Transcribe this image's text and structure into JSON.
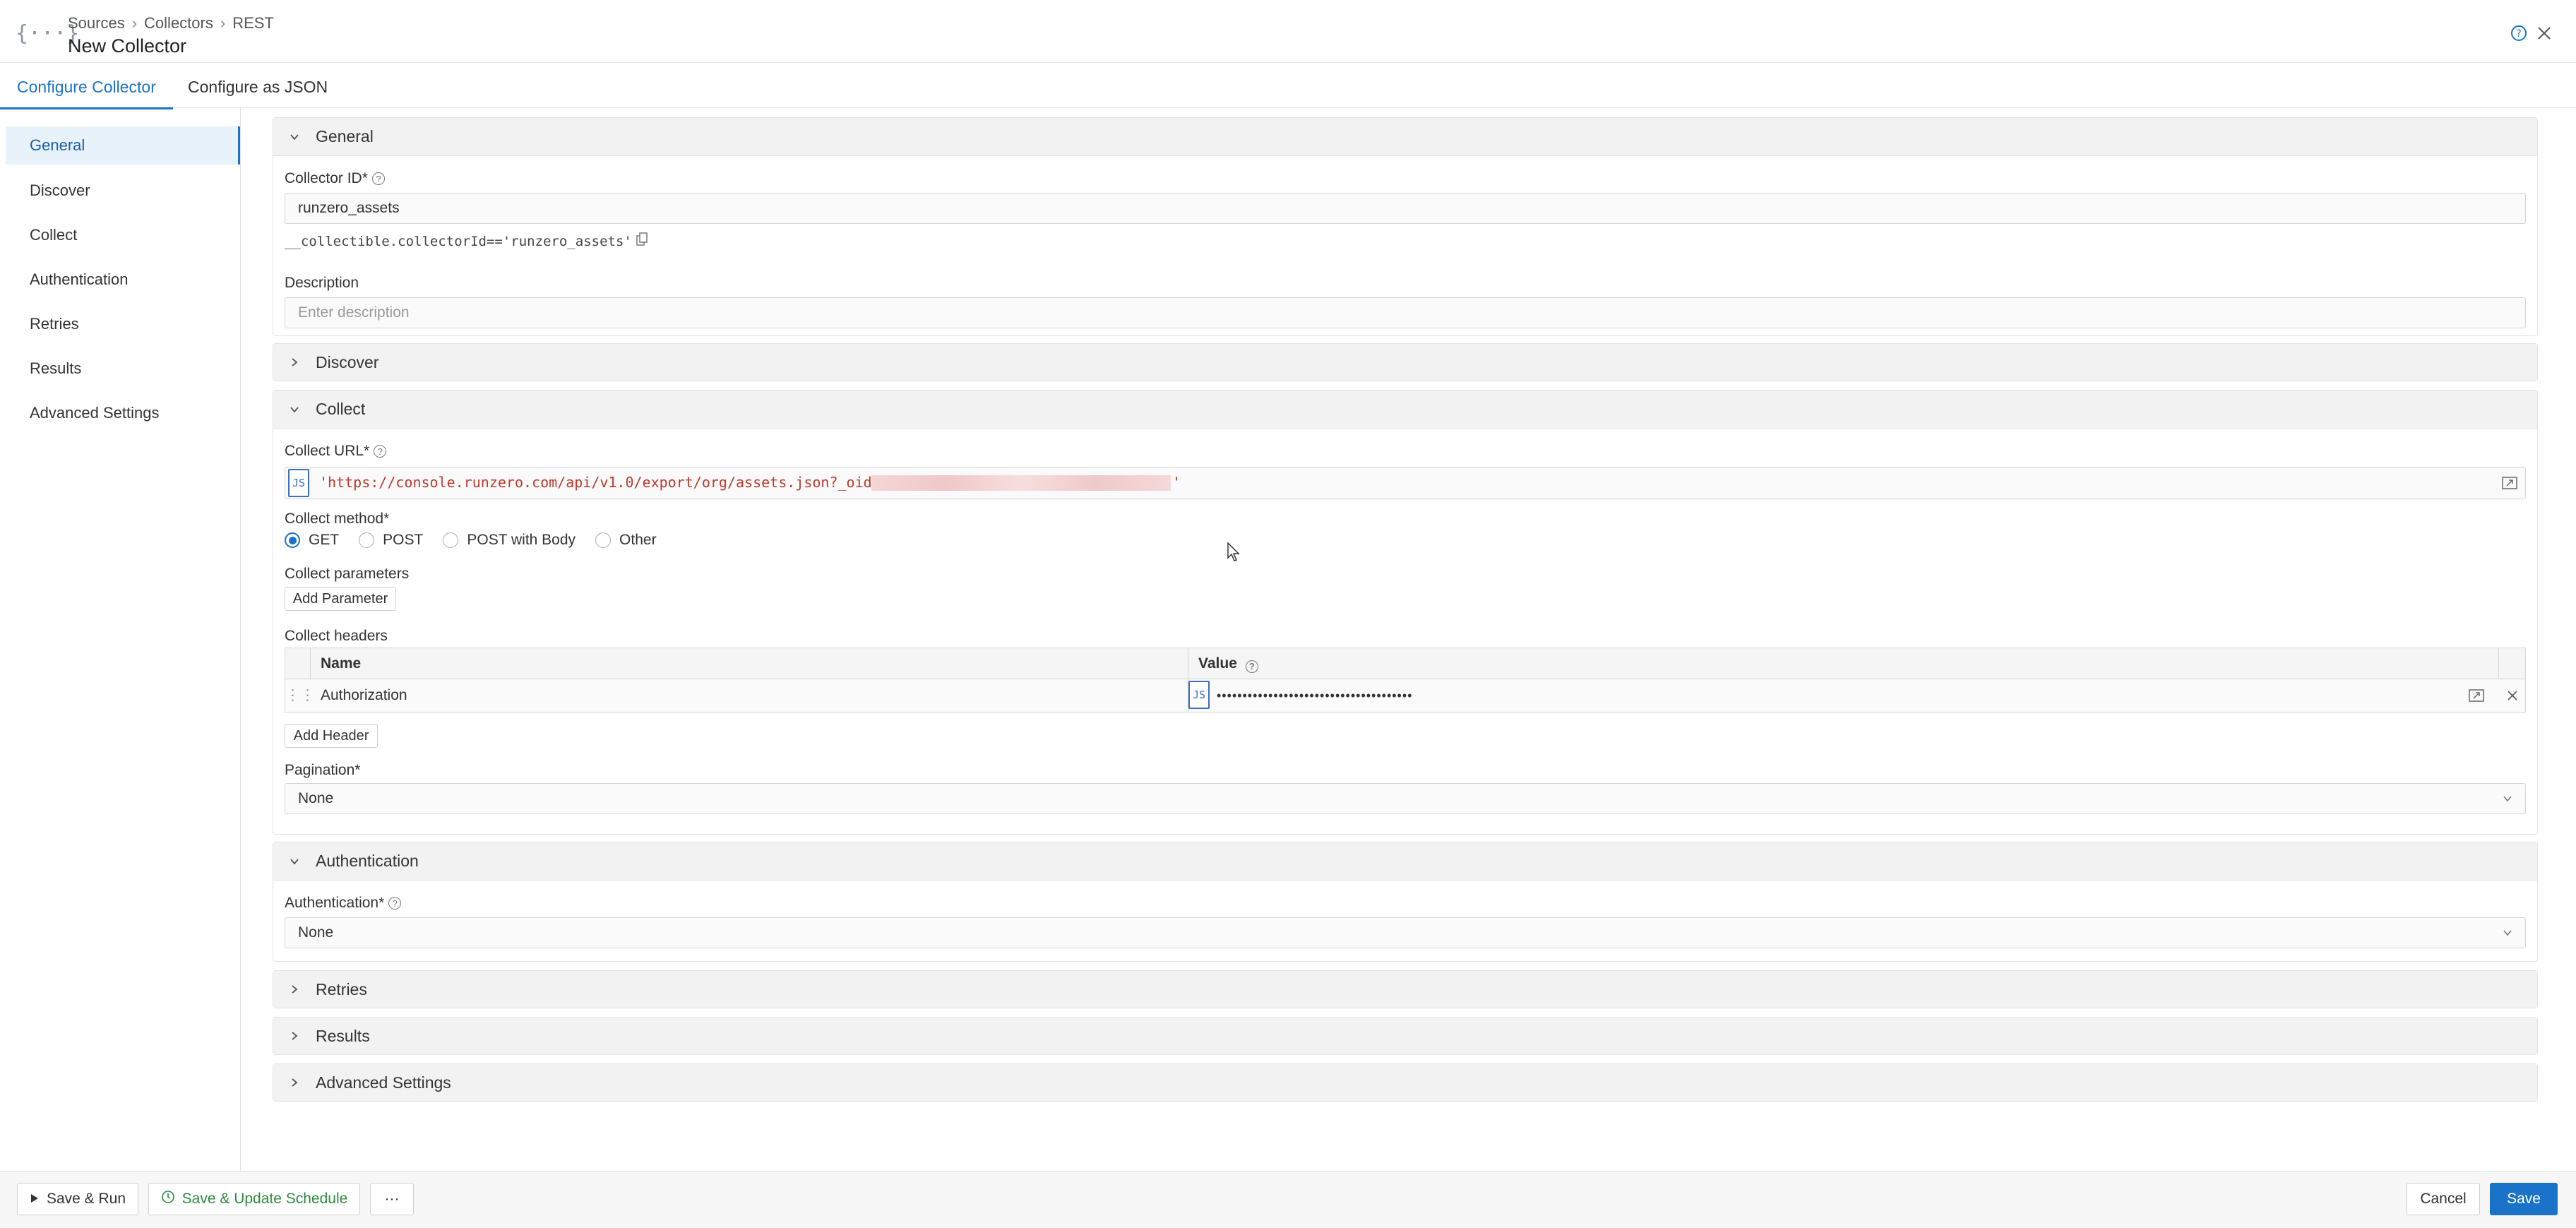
{
  "header": {
    "breadcrumb": [
      "Sources",
      "Collectors",
      "REST"
    ],
    "title": "New Collector",
    "icon": "curly-braces-icon"
  },
  "tabs": [
    {
      "label": "Configure Collector",
      "active": true
    },
    {
      "label": "Configure as JSON",
      "active": false
    }
  ],
  "sidebar": {
    "items": [
      {
        "label": "General",
        "active": true
      },
      {
        "label": "Discover"
      },
      {
        "label": "Collect"
      },
      {
        "label": "Authentication"
      },
      {
        "label": "Retries"
      },
      {
        "label": "Results"
      },
      {
        "label": "Advanced Settings"
      }
    ]
  },
  "general": {
    "heading": "General",
    "collector_id_label": "Collector ID*",
    "collector_id_value": "runzero_assets",
    "collector_expr": "__collectible.collectorId=='runzero_assets'",
    "description_label": "Description",
    "description_placeholder": "Enter description"
  },
  "discover": {
    "heading": "Discover"
  },
  "collect": {
    "heading": "Collect",
    "url_label": "Collect URL*",
    "js_badge": "JS",
    "url_value": "'https://console.runzero.com/api/v1.0/export/org/assets.json?_oid=",
    "url_closing": "'",
    "method_label": "Collect method*",
    "methods": [
      {
        "label": "GET",
        "checked": true
      },
      {
        "label": "POST",
        "checked": false
      },
      {
        "label": "POST with Body",
        "checked": false
      },
      {
        "label": "Other",
        "checked": false
      }
    ],
    "params_label": "Collect parameters",
    "add_parameter": "Add Parameter",
    "headers_label": "Collect headers",
    "col_name": "Name",
    "col_value": "Value",
    "header_row": {
      "name": "Authorization",
      "value": "••••••••••••••••••••••••••••••••••••••"
    },
    "add_header": "Add Header",
    "pagination_label": "Pagination*",
    "pagination_value": "None"
  },
  "authentication": {
    "heading": "Authentication",
    "label": "Authentication*",
    "value": "None"
  },
  "retries": {
    "heading": "Retries"
  },
  "results": {
    "heading": "Results"
  },
  "advanced": {
    "heading": "Advanced Settings"
  },
  "footer": {
    "save_run": "Save & Run",
    "save_schedule": "Save & Update Schedule",
    "more": "···",
    "cancel": "Cancel",
    "save": "Save"
  },
  "colors": {
    "accent": "#1a73c8",
    "url_text": "#c0392b",
    "schedule_green": "#2e8b3c"
  }
}
